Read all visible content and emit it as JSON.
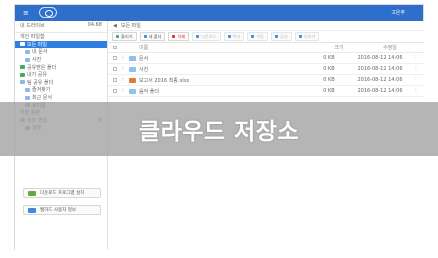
{
  "topbar": {
    "menu_icon": "≡",
    "user_name": "고은주"
  },
  "sidebar": {
    "header_left": "내 드라이브",
    "header_right": "04.68",
    "items": [
      {
        "label": "개인 파일함",
        "level": 0,
        "active": false,
        "icon": "none"
      },
      {
        "label": "모든 파일",
        "level": 0,
        "active": true,
        "icon": "folder-icon"
      },
      {
        "label": "내 문서",
        "level": 1,
        "active": false,
        "icon": "folder-icon"
      },
      {
        "label": "사진",
        "level": 1,
        "active": false,
        "icon": "folder-icon"
      },
      {
        "label": "공유받은 폴더",
        "level": 0,
        "active": false,
        "icon": "share-icon",
        "green": true
      },
      {
        "label": "내가 공유",
        "level": 0,
        "active": false,
        "icon": "share-icon",
        "green": true
      },
      {
        "label": "팀 공유 폴더",
        "level": 0,
        "active": false,
        "icon": "team-icon"
      },
      {
        "label": "즐겨찾기",
        "level": 1,
        "active": false,
        "icon": "star-icon"
      },
      {
        "label": "최근 문서",
        "level": 1,
        "active": false,
        "icon": "clock-icon"
      },
      {
        "label": "휴지통",
        "level": 1,
        "active": false,
        "icon": "trash-icon"
      },
      {
        "label": "저장 용량",
        "level": 0,
        "active": false,
        "icon": "none"
      },
      {
        "label": "외부 연결",
        "level": 0,
        "active": false,
        "icon": "link-icon",
        "gear": true
      },
      {
        "label": "설정",
        "level": 1,
        "active": false,
        "icon": "gear-icon"
      }
    ],
    "buttons": [
      {
        "label": "다운로드 프로그램 설치"
      },
      {
        "label": "웹하드 사용자 정보"
      }
    ]
  },
  "main": {
    "breadcrumb": [
      "◀",
      "모든 파일"
    ],
    "toolbar": [
      {
        "label": "올리기",
        "style": "green"
      },
      {
        "label": "새 폴더",
        "style": ""
      },
      {
        "label": "삭제",
        "style": "red"
      },
      {
        "label": "다운로드",
        "style": "dim"
      },
      {
        "label": "복사",
        "style": "dim"
      },
      {
        "label": "이동",
        "style": "dim"
      },
      {
        "label": "공유",
        "style": "dim"
      },
      {
        "label": "더보기",
        "style": "dim"
      }
    ],
    "columns": [
      "이름",
      "크기",
      "수정일"
    ],
    "rows": [
      {
        "name": "문서",
        "size": "0 KB",
        "date": "2016-08-12 14:06",
        "icon": "folder-icon"
      },
      {
        "name": "사진",
        "size": "0 KB",
        "date": "2016-08-12 14:06",
        "icon": "folder-icon"
      },
      {
        "name": "보고서 2016 최종.xlsx",
        "size": "0 KB",
        "date": "2016-08-12 14:06",
        "icon": "doc-icon"
      },
      {
        "name": "음악 폴더",
        "size": "0 KB",
        "date": "2016-08-12 14:06",
        "icon": "folder-icon"
      }
    ]
  },
  "banner": {
    "text": "클라우드 저장소"
  }
}
